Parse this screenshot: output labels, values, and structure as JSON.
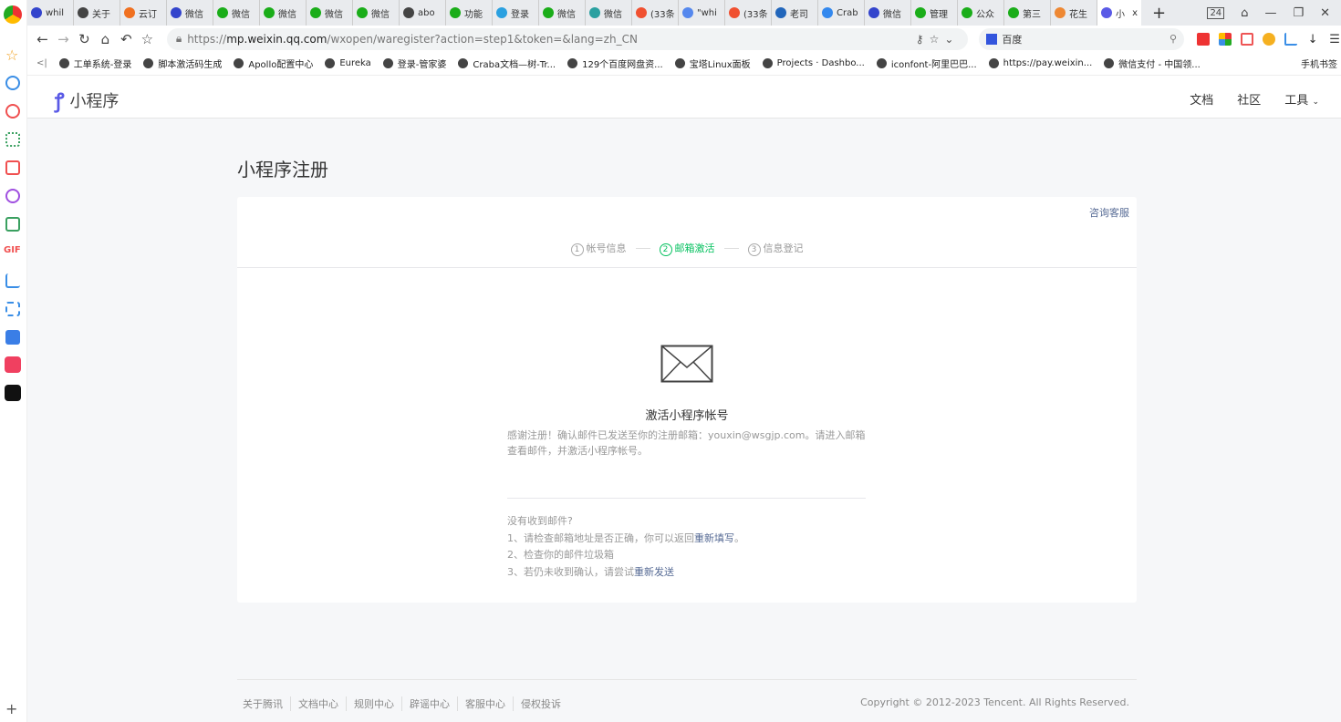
{
  "browser": {
    "tabs": [
      {
        "label": "whil",
        "color": "#3344cc"
      },
      {
        "label": "关于",
        "color": "#444"
      },
      {
        "label": "云订",
        "color": "#f07020"
      },
      {
        "label": "微信",
        "color": "#3344cc"
      },
      {
        "label": "微信",
        "color": "#1aad19"
      },
      {
        "label": "微信",
        "color": "#1aad19"
      },
      {
        "label": "微信",
        "color": "#1aad19"
      },
      {
        "label": "微信",
        "color": "#1aad19"
      },
      {
        "label": "abo",
        "color": "#444"
      },
      {
        "label": "功能",
        "color": "#1aad19"
      },
      {
        "label": "登录",
        "color": "#2aa0e0"
      },
      {
        "label": "微信",
        "color": "#1aad19"
      },
      {
        "label": "微信",
        "color": "#2aa0a0"
      },
      {
        "label": "(33条",
        "color": "#f05030"
      },
      {
        "label": "\"whi",
        "color": "#5588ee"
      },
      {
        "label": "(33条",
        "color": "#f05030"
      },
      {
        "label": "老司",
        "color": "#2266bb"
      },
      {
        "label": "Crab",
        "color": "#3388ee"
      },
      {
        "label": "微信",
        "color": "#3344cc"
      },
      {
        "label": "管理",
        "color": "#1aad19"
      },
      {
        "label": "公众",
        "color": "#1aad19"
      },
      {
        "label": "第三",
        "color": "#1aad19"
      },
      {
        "label": "花生",
        "color": "#ee8833"
      }
    ],
    "active_tab": {
      "label": "小",
      "close": "x",
      "color": "#5a5ae6"
    },
    "new_tab": "+",
    "tab_count": "24",
    "url_scheme": "https://",
    "url_host": "mp.weixin.qq.com",
    "url_path": "/wxopen/waregister?action=step1&token=&lang=zh_CN",
    "search_engine": "百度",
    "bookmarks": [
      "工单系统-登录",
      "脚本激活码生成",
      "Apollo配置中心",
      "Eureka",
      "登录-管家婆",
      "Craba文档—树-Tr...",
      "129个百度网盘资...",
      "宝塔Linux面板",
      "Projects · Dashbo...",
      "iconfont-阿里巴巴...",
      "https://pay.weixin...",
      "微信支付 - 中国领..."
    ],
    "mobile_bookmarks": "手机书签"
  },
  "header": {
    "logo": "小程序",
    "nav": [
      "文档",
      "社区",
      "工具"
    ]
  },
  "main": {
    "title": "小程序注册",
    "help": "咨询客服",
    "steps": [
      {
        "num": "1",
        "label": "帐号信息",
        "active": false
      },
      {
        "num": "2",
        "label": "邮箱激活",
        "active": true
      },
      {
        "num": "3",
        "label": "信息登记",
        "active": false
      }
    ],
    "activate_title": "激活小程序帐号",
    "message": "感谢注册！确认邮件已发送至你的注册邮箱：youxin@wsgjp.com。请进入邮箱查看邮件，并激活小程序帐号。",
    "tips_title": "没有收到邮件?",
    "tip1": "1、请检查邮箱地址是否正确，你可以返回",
    "tip1_link": "重新填写",
    "tip1_end": "。",
    "tip2": "2、检查你的邮件垃圾箱",
    "tip3": "3、若仍未收到确认，请尝试",
    "tip3_link": "重新发送"
  },
  "footer": {
    "links": [
      "关于腾讯",
      "文档中心",
      "规则中心",
      "辟谣中心",
      "客服中心",
      "侵权投诉"
    ],
    "copyright": "Copyright © 2012-2023 Tencent. All Rights Reserved."
  },
  "colors": {
    "accent": "#07c160",
    "link": "#576b95",
    "brand": "#5a5ae6"
  }
}
